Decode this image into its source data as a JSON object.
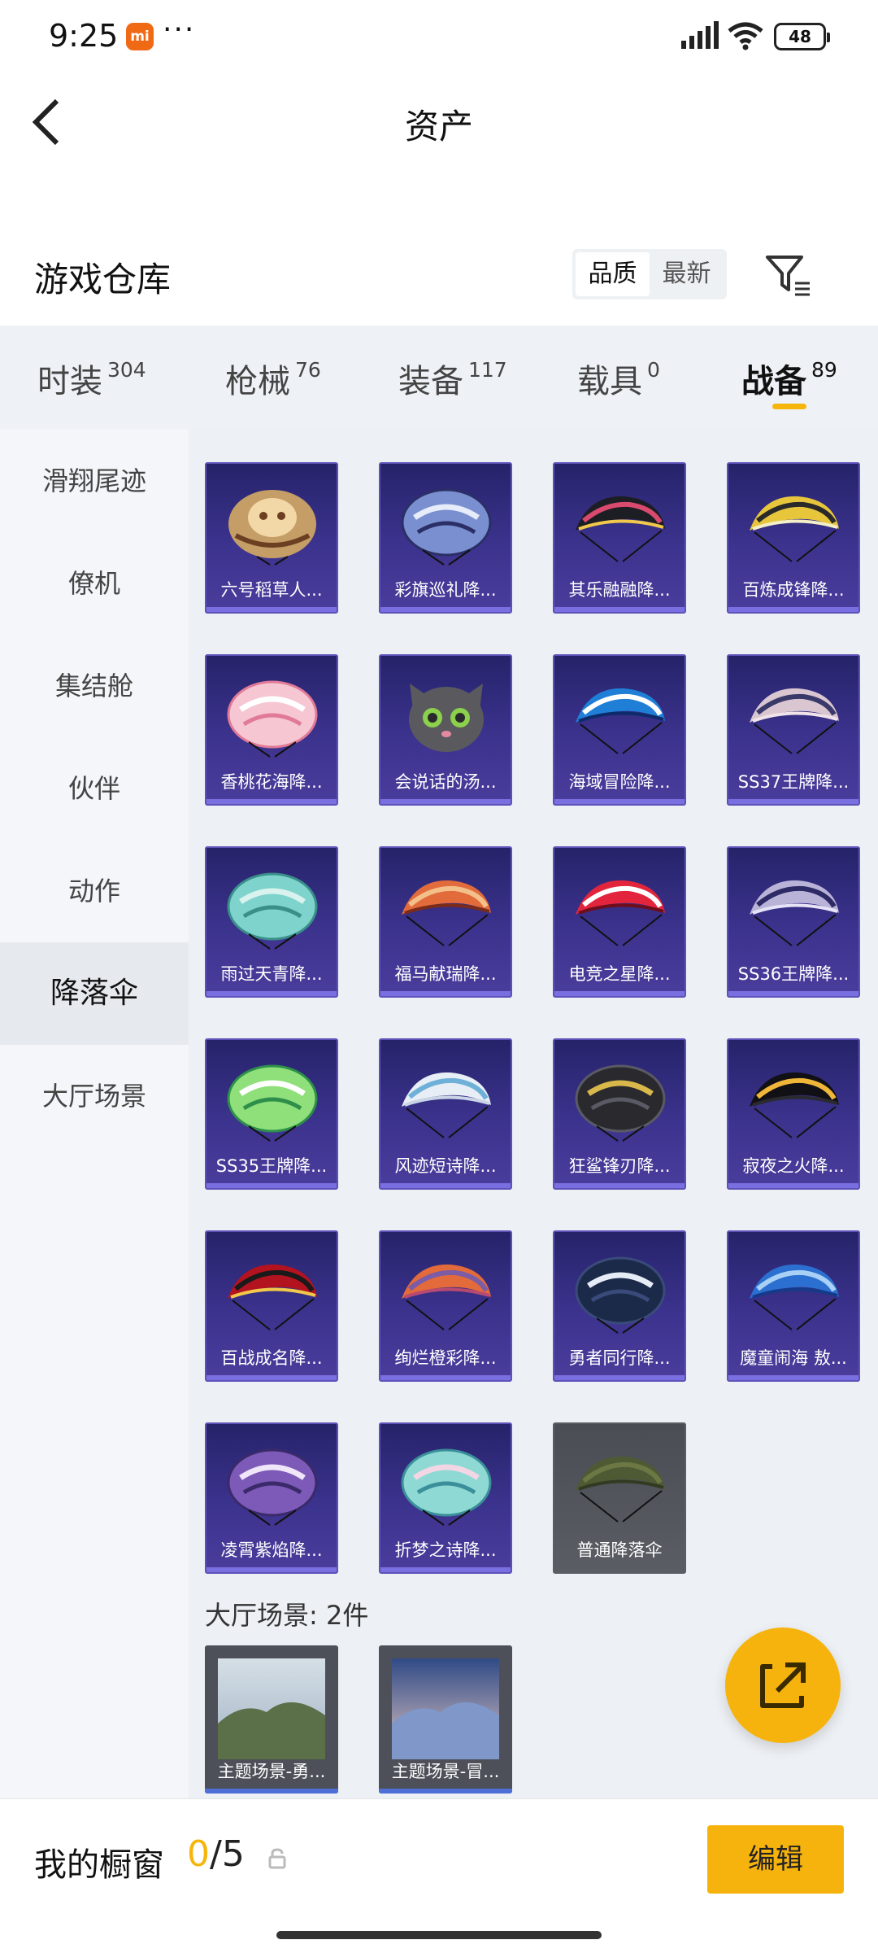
{
  "status_bar": {
    "time": "9:25",
    "battery": "48",
    "mi_badge": "mi",
    "more": "···"
  },
  "header": {
    "title": "资产"
  },
  "warehouse": {
    "title": "游戏仓库",
    "sort_options": [
      "品质",
      "最新"
    ],
    "active_sort": "品质"
  },
  "tabs": [
    {
      "label": "时装",
      "count": "304"
    },
    {
      "label": "枪械",
      "count": "76"
    },
    {
      "label": "装备",
      "count": "117"
    },
    {
      "label": "载具",
      "count": "0"
    },
    {
      "label": "战备",
      "count": "89",
      "active": true
    }
  ],
  "sidebar": {
    "items": [
      "滑翔尾迹",
      "僚机",
      "集结舱",
      "伙伴",
      "动作",
      "降落伞",
      "大厅场景"
    ],
    "active": "降落伞"
  },
  "items": [
    {
      "label": "六号稻草人...",
      "art": "scarecrow",
      "colors": [
        "#c59d66",
        "#6b3f22",
        "#f2d7a7"
      ]
    },
    {
      "label": "彩旗巡礼降...",
      "art": "dome",
      "colors": [
        "#7a8fd0",
        "#e6ecfa",
        "#2b2f66"
      ]
    },
    {
      "label": "其乐融融降...",
      "art": "wing",
      "colors": [
        "#1d1d24",
        "#d84a6e",
        "#f0c94a"
      ]
    },
    {
      "label": "百炼成锋降...",
      "art": "wing",
      "colors": [
        "#e7c63c",
        "#2a2a2a",
        "#f5efc8"
      ]
    },
    {
      "label": "香桃花海降...",
      "art": "dome",
      "colors": [
        "#f6c6d2",
        "#ffffff",
        "#e07a97"
      ]
    },
    {
      "label": "会说话的汤...",
      "art": "cat",
      "colors": [
        "#5a5a5e",
        "#8bd14b",
        "#2a2a2e"
      ]
    },
    {
      "label": "海域冒险降...",
      "art": "wing",
      "colors": [
        "#1f7fd6",
        "#ffffff",
        "#0d2b6b"
      ]
    },
    {
      "label": "SS37王牌降...",
      "art": "wing",
      "colors": [
        "#d9c6d0",
        "#3a3a6a",
        "#f0e4ea"
      ]
    },
    {
      "label": "雨过天青降...",
      "art": "dome",
      "colors": [
        "#7fd3cd",
        "#d9f2ee",
        "#3b8f8a"
      ]
    },
    {
      "label": "福马献瑞降...",
      "art": "wing",
      "colors": [
        "#e26b3c",
        "#f4c08a",
        "#7a2b1a"
      ]
    },
    {
      "label": "电竞之星降...",
      "art": "wing",
      "colors": [
        "#e2253d",
        "#ffffff",
        "#6e0e1c"
      ]
    },
    {
      "label": "SS36王牌降...",
      "art": "wing",
      "colors": [
        "#b9b3d8",
        "#2d2a66",
        "#e6e3f6"
      ]
    },
    {
      "label": "SS35王牌降...",
      "art": "dome",
      "colors": [
        "#8fe07a",
        "#ffffff",
        "#2d8f4a"
      ]
    },
    {
      "label": "风迹短诗降...",
      "art": "wing",
      "colors": [
        "#e8eef5",
        "#6fb0d8",
        "#c9d4e6"
      ]
    },
    {
      "label": "狂鲨锋刃降...",
      "art": "dome",
      "colors": [
        "#2a2a2e",
        "#d8b84a",
        "#5a5a66"
      ]
    },
    {
      "label": "寂夜之火降...",
      "art": "wing",
      "colors": [
        "#111115",
        "#f0b63a",
        "#2a2a30"
      ]
    },
    {
      "label": "百战成名降...",
      "art": "wing",
      "colors": [
        "#b3121f",
        "#1a1a1a",
        "#f2c84a"
      ]
    },
    {
      "label": "绚烂橙彩降...",
      "art": "wing",
      "colors": [
        "#e36a3a",
        "#7b5ca6",
        "#b84a72"
      ]
    },
    {
      "label": "勇者同行降...",
      "art": "dome",
      "colors": [
        "#1c2a4a",
        "#e6ecf6",
        "#3a4a7a"
      ]
    },
    {
      "label": "魔童闹海 敖...",
      "art": "wing",
      "colors": [
        "#2b6fd0",
        "#a9d0f5",
        "#163a8a"
      ]
    },
    {
      "label": "凌霄紫焰降...",
      "art": "dome",
      "colors": [
        "#7d5ab8",
        "#f0e6fa",
        "#3a2a6a"
      ]
    },
    {
      "label": "折梦之诗降...",
      "art": "dome",
      "colors": [
        "#8fd9d4",
        "#f2d6e4",
        "#3a8f9a"
      ]
    },
    {
      "label": "普通降落伞",
      "art": "wing",
      "colors": [
        "#4e5a34",
        "#6b7844",
        "#333a22"
      ],
      "grey": true
    }
  ],
  "scenes": {
    "heading": "大厅场景: 2件",
    "items": [
      {
        "label": "主题场景-勇...",
        "colors": [
          "#9fb2c4",
          "#5b7048",
          "#d6dfe6"
        ]
      },
      {
        "label": "主题场景-冒...",
        "colors": [
          "#e2c7c4",
          "#7f97c9",
          "#304a86"
        ]
      }
    ]
  },
  "footer": {
    "label": "我的橱窗",
    "count_current": "0",
    "count_total": "/5",
    "edit_label": "编辑"
  },
  "accent_color": "#f6b30d"
}
